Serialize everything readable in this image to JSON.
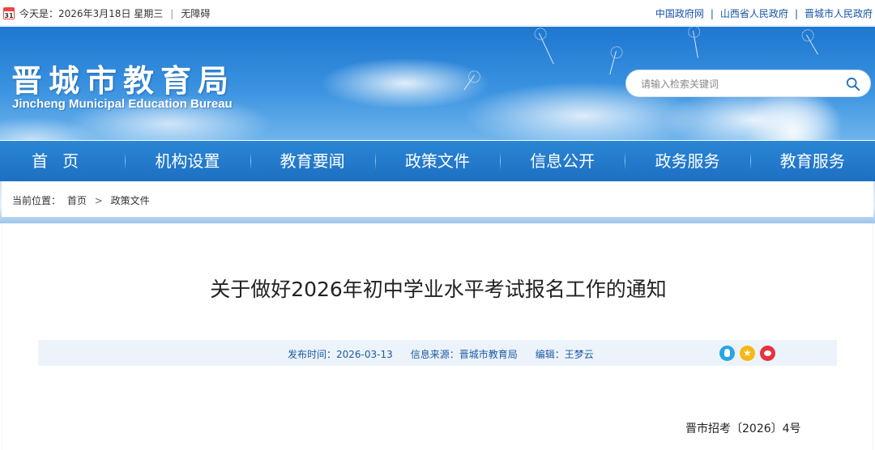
{
  "topbar": {
    "calendar_day": "31",
    "date_text": "今天是：2026年3月18日 星期三",
    "separator": "|",
    "accessibility": "无障碍",
    "links": [
      "中国政府网",
      "山西省人民政府",
      "晋城市人民政府"
    ]
  },
  "header": {
    "title": "晋城市教育局",
    "subtitle": "Jincheng Municipal Education Bureau",
    "search_placeholder": "请输入检索关键词"
  },
  "nav": {
    "items": [
      "首页",
      "机构设置",
      "教育要闻",
      "政策文件",
      "信息公开",
      "政务服务",
      "教育服务"
    ]
  },
  "breadcrumb": {
    "label": "当前位置：",
    "home": "首页",
    "arrow": ">",
    "current": "政策文件"
  },
  "article": {
    "title": "关于做好2026年初中学业水平考试报名工作的通知",
    "publish_time": "发布时间：2026-03-13",
    "source": "信息来源：晋城市教育局",
    "editor": "编辑：王梦云",
    "doc_number": "晋市招考〔2026〕4号"
  },
  "share": {
    "icons": [
      "qq-icon",
      "qzone-icon",
      "weibo-icon"
    ],
    "qzone_glyph": "★"
  },
  "colors": {
    "nav_bg": "#1d6fc1",
    "link": "#1553a8",
    "meta_text": "#1a5aa6"
  }
}
